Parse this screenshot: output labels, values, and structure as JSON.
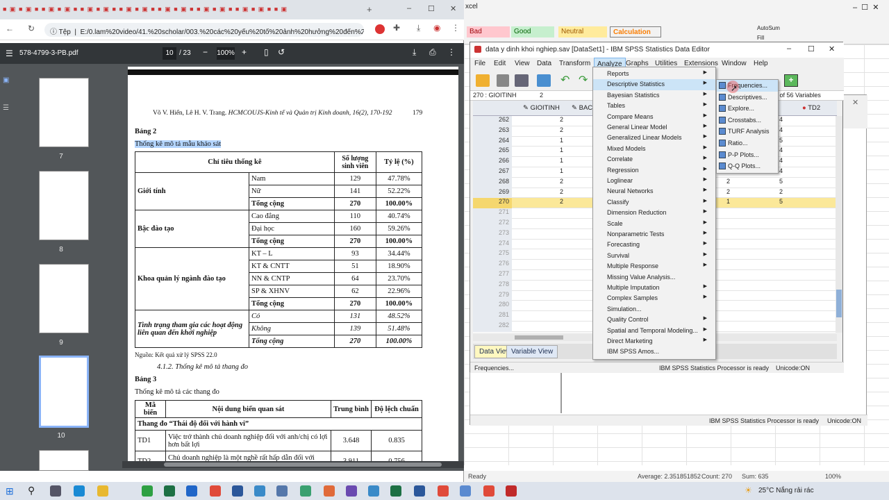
{
  "browser": {
    "tab_strip_text": "E/0.lam%20video/41.%20scholar/003.%20các%20yếu%20tố%20ảnh%20hưởng%20đến%20ý...",
    "site_label": "Tệp",
    "url": "E:/0.lam%20video/41.%20scholar/003.%20các%20yếu%20tố%20ảnh%20hưởng%20đến%20ý...",
    "window_min": "–",
    "window_max": "☐",
    "window_close": "✕"
  },
  "pdf": {
    "file_name": "578-4799-3-PB.pdf",
    "current_page": "10",
    "total_pages": "/ 23",
    "zoom": "100%",
    "thumb_labels": [
      "7",
      "8",
      "9",
      "10"
    ],
    "header_authors": "Võ V. Hiển, Lê H. V. Trang.",
    "header_journal": "HCMCOUJS-Kinh tế và Quản trị Kinh doanh, 16(2), 170-192",
    "header_page": "179",
    "table2_label": "Bảng 2",
    "table2_title": "Thống kê mô tả mẫu khảo sát",
    "table2_headers": [
      "Chỉ tiêu thống kê",
      "Số lượng sinh viên",
      "Tỷ lệ (%)"
    ],
    "groups": [
      {
        "name": "Giới tính",
        "rows": [
          [
            "Nam",
            "129",
            "47.78%"
          ],
          [
            "Nữ",
            "141",
            "52.22%"
          ],
          [
            "Tổng cộng",
            "270",
            "100.00%"
          ]
        ]
      },
      {
        "name": "Bậc đào tạo",
        "rows": [
          [
            "Cao đẳng",
            "110",
            "40.74%"
          ],
          [
            "Đại học",
            "160",
            "59.26%"
          ],
          [
            "Tổng cộng",
            "270",
            "100.00%"
          ]
        ]
      },
      {
        "name": "Khoa quản lý ngành đào tạo",
        "rows": [
          [
            "KT – L",
            "93",
            "34.44%"
          ],
          [
            "KT & CNTT",
            "51",
            "18.90%"
          ],
          [
            "NN & CNTP",
            "64",
            "23.70%"
          ],
          [
            "SP & XHNV",
            "62",
            "22.96%"
          ],
          [
            "Tổng cộng",
            "270",
            "100.00%"
          ]
        ]
      },
      {
        "name": "Tình trạng tham gia các hoạt động liên quan đến khởi nghiệp",
        "rows": [
          [
            "Có",
            "131",
            "48.52%"
          ],
          [
            "Không",
            "139",
            "51.48%"
          ],
          [
            "Tổng cộng",
            "270",
            "100.00%"
          ]
        ]
      }
    ],
    "source_note": "Nguồn: Kết quả xử lý SPSS 22.0",
    "section_heading": "4.1.2. Thống kê mô tả thang đo",
    "table3_label": "Bảng 3",
    "table3_title": "Thống kê mô tả các thang đo",
    "table3_headers": [
      "Mã biến",
      "Nội dung biến quan sát",
      "Trung bình",
      "Độ lệch chuẩn"
    ],
    "table3_scale": "Thang đo “Thái độ đối với hành vi”",
    "table3_rows": [
      [
        "TD1",
        "Việc trở thành chủ doanh nghiệp đối với anh/chị có lợi hơn bất lợi",
        "3.648",
        "0.835"
      ],
      [
        "TD2",
        "Chủ doanh nghiệp là một nghề rất hấp dẫn đối với anh/chị",
        "3.911",
        "0.756"
      ]
    ]
  },
  "excel": {
    "styles": [
      "Bad",
      "Good",
      "Neutral",
      "Calculation"
    ],
    "autosum": "AutoSum",
    "fill": "Fill",
    "title_fragment": "xcel",
    "status_ready": "Ready",
    "status_average": "Average: 2.351851852",
    "status_count": "Count: 270",
    "status_sum": "Sum: 635",
    "status_zoom": "100%"
  },
  "spss": {
    "title": "data y dinh khoi nghiep.sav [DataSet1] - IBM SPSS Statistics Data Editor",
    "menu": [
      "File",
      "Edit",
      "View",
      "Data",
      "Transform",
      "Analyze",
      "Graphs",
      "Utilities",
      "Extensions",
      "Window",
      "Help"
    ],
    "cell_ref": "270 : GIOITINH",
    "cell_value": "2",
    "visible_vars": "ible: 56 of 56 Variables",
    "columns": [
      "GIOITINH",
      "BACD",
      "TD2"
    ],
    "rows": [
      {
        "n": "262",
        "a": "2",
        "b": "",
        "c": "4"
      },
      {
        "n": "263",
        "a": "2",
        "b": "",
        "c": "4"
      },
      {
        "n": "264",
        "a": "1",
        "b": "",
        "c": "5"
      },
      {
        "n": "265",
        "a": "1",
        "b": "",
        "c": "4"
      },
      {
        "n": "266",
        "a": "1",
        "b": "",
        "c": "4"
      },
      {
        "n": "267",
        "a": "1",
        "b": "2",
        "c": "4"
      },
      {
        "n": "268",
        "a": "2",
        "b": "2",
        "c": "5"
      },
      {
        "n": "269",
        "a": "2",
        "b": "2",
        "c": "2"
      },
      {
        "n": "270",
        "a": "2",
        "b": "1",
        "c": "5"
      },
      {
        "n": "271",
        "a": "",
        "b": "",
        "c": ""
      },
      {
        "n": "272",
        "a": "",
        "b": "",
        "c": ""
      },
      {
        "n": "273",
        "a": "",
        "b": "",
        "c": ""
      },
      {
        "n": "274",
        "a": "",
        "b": "",
        "c": ""
      },
      {
        "n": "275",
        "a": "",
        "b": "",
        "c": ""
      },
      {
        "n": "276",
        "a": "",
        "b": "",
        "c": ""
      },
      {
        "n": "277",
        "a": "",
        "b": "",
        "c": ""
      },
      {
        "n": "278",
        "a": "",
        "b": "",
        "c": ""
      },
      {
        "n": "279",
        "a": "",
        "b": "",
        "c": ""
      },
      {
        "n": "280",
        "a": "",
        "b": "",
        "c": ""
      },
      {
        "n": "281",
        "a": "",
        "b": "",
        "c": ""
      },
      {
        "n": "282",
        "a": "",
        "b": "",
        "c": ""
      }
    ],
    "data_view": "Data View",
    "variable_view": "Variable View",
    "status_left": "Frequencies...",
    "status_processor": "IBM SPSS Statistics Processor is ready",
    "status_unicode": "Unicode:ON",
    "back_status_processor": "IBM SPSS Statistics Processor is ready",
    "back_status_unicode": "Unicode:ON"
  },
  "analyze_menu": [
    {
      "label": "Reports",
      "sub": true
    },
    {
      "label": "Descriptive Statistics",
      "sub": true,
      "hl": true
    },
    {
      "label": "Bayesian Statistics",
      "sub": true
    },
    {
      "label": "Tables",
      "sub": true
    },
    {
      "label": "Compare Means",
      "sub": true
    },
    {
      "label": "General Linear Model",
      "sub": true
    },
    {
      "label": "Generalized Linear Models",
      "sub": true
    },
    {
      "label": "Mixed Models",
      "sub": true
    },
    {
      "label": "Correlate",
      "sub": true
    },
    {
      "label": "Regression",
      "sub": true
    },
    {
      "label": "Loglinear",
      "sub": true
    },
    {
      "label": "Neural Networks",
      "sub": true
    },
    {
      "label": "Classify",
      "sub": true
    },
    {
      "label": "Dimension Reduction",
      "sub": true
    },
    {
      "label": "Scale",
      "sub": true
    },
    {
      "label": "Nonparametric Tests",
      "sub": true
    },
    {
      "label": "Forecasting",
      "sub": true
    },
    {
      "label": "Survival",
      "sub": true
    },
    {
      "label": "Multiple Response",
      "sub": true
    },
    {
      "label": "Missing Value Analysis...",
      "sub": false
    },
    {
      "label": "Multiple Imputation",
      "sub": true
    },
    {
      "label": "Complex Samples",
      "sub": true
    },
    {
      "label": "Simulation...",
      "sub": false
    },
    {
      "label": "Quality Control",
      "sub": true
    },
    {
      "label": "Spatial and Temporal Modeling...",
      "sub": true
    },
    {
      "label": "Direct Marketing",
      "sub": true
    },
    {
      "label": "IBM SPSS Amos...",
      "sub": false
    }
  ],
  "desc_submenu": [
    "Frequencies...",
    "Descriptives...",
    "Explore...",
    "Crosstabs...",
    "TURF Analysis",
    "Ratio...",
    "P-P Plots...",
    "Q-Q Plots..."
  ],
  "taskbar": {
    "weather": "25°C  Nắng rải rác"
  }
}
